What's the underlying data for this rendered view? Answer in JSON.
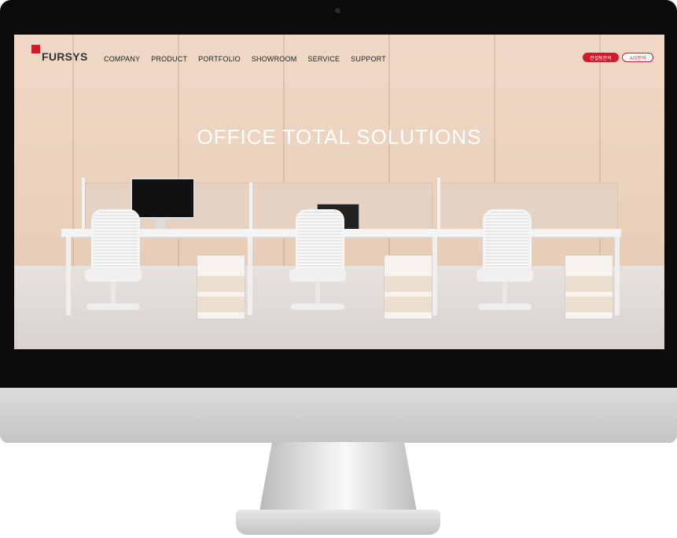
{
  "site": {
    "logo_text": "FURSYS",
    "nav": [
      "COMPANY",
      "PRODUCT",
      "PORTFOLIO",
      "SHOWROOM",
      "SERVICE",
      "SUPPORT"
    ],
    "buttons": {
      "consult": "컨설팅문의",
      "as": "A/S문의"
    },
    "hero_title": "OFFICE TOTAL SOLUTIONS"
  },
  "colors": {
    "brand_red": "#d11a2a",
    "wood": "#e9d0bb"
  },
  "icons": {
    "logo_mark": "red-square-icon"
  }
}
